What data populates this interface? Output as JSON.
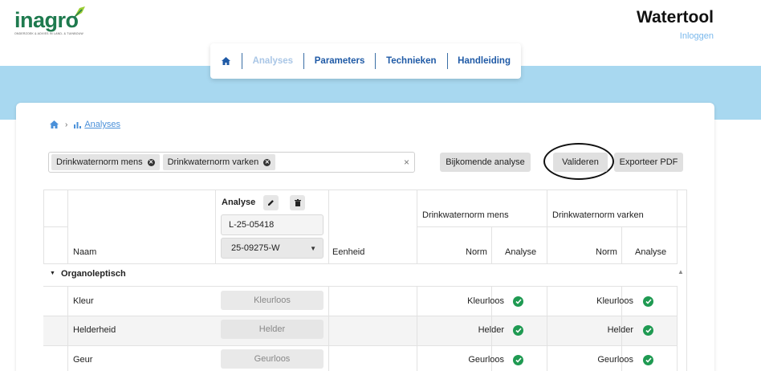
{
  "header": {
    "logo_text": "inagro",
    "logo_tagline": "ONDERZOEK & ADVIES IN LAND- & TUINBOUW",
    "app_title": "Watertool",
    "login_label": "Inloggen"
  },
  "nav": {
    "home_icon": "home-icon",
    "items": [
      {
        "label": "Analyses",
        "active": true
      },
      {
        "label": "Parameters",
        "active": false
      },
      {
        "label": "Technieken",
        "active": false
      },
      {
        "label": "Handleiding",
        "active": false
      }
    ]
  },
  "breadcrumb": {
    "current": "Analyses"
  },
  "filter": {
    "tags": [
      "Drinkwaternorm mens",
      "Drinkwaternorm varken"
    ],
    "clear_symbol": "×"
  },
  "actions": {
    "extra_analysis": "Bijkomende analyse",
    "validate": "Valideren",
    "export_pdf": "Exporteer PDF"
  },
  "table": {
    "col_name": "Naam",
    "col_analyse": "Analyse",
    "analysis_code": "L-25-05418",
    "sample_selected": "25-09275-W",
    "col_unit": "Eenheid",
    "norm_groups": [
      "Drinkwaternorm mens",
      "Drinkwaternorm varken"
    ],
    "sub_norm": "Norm",
    "sub_analyse": "Analyse",
    "group_label": "Organoleptisch",
    "rows": [
      {
        "name": "Kleur",
        "value": "Kleurloos",
        "norm1": "Kleurloos",
        "norm2": "Kleurloos"
      },
      {
        "name": "Helderheid",
        "value": "Helder",
        "norm1": "Helder",
        "norm2": "Helder"
      },
      {
        "name": "Geur",
        "value": "Geurloos",
        "norm1": "Geurloos",
        "norm2": "Geurloos"
      }
    ]
  }
}
